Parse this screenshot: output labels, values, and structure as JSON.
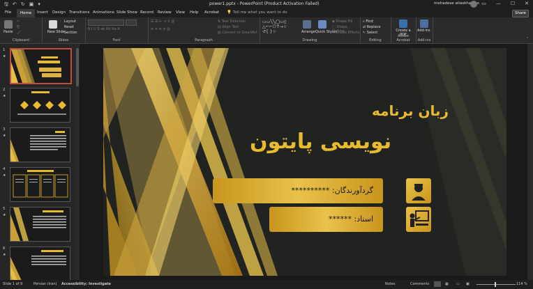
{
  "titlebar": {
    "autosave": "",
    "filename": "power1.pptx - PowerPoint (Product Activation Failed)",
    "user": "mohadese aliaskhanloo"
  },
  "tabs": [
    "File",
    "Home",
    "Insert",
    "Design",
    "Transitions",
    "Animations",
    "Slide Show",
    "Record",
    "Review",
    "View",
    "Help",
    "Acrobat"
  ],
  "tell_me": "Tell me what you want to do",
  "share_label": "Share",
  "ribbon": {
    "clipboard": {
      "label": "Clipboard",
      "paste": "Paste"
    },
    "slides": {
      "label": "Slides",
      "new_slide": "New Slide",
      "layout": "Layout",
      "reset": "Reset",
      "section": "Section"
    },
    "font": {
      "label": "Font"
    },
    "paragraph": {
      "label": "Paragraph"
    },
    "drawing": {
      "label": "Drawing",
      "arrange": "Arrange",
      "quick_styles": "Quick Styles"
    },
    "editing": {
      "label": "Editing",
      "find": "Find",
      "replace": "Replace",
      "select": "Select"
    },
    "adobe": {
      "label": "Adobe Acrobat",
      "create_pdf": "Create a PDF"
    },
    "addins": {
      "label": "Add-ins",
      "addins": "Add-ins"
    }
  },
  "thumbnails": [
    {
      "num": "1",
      "selected": true
    },
    {
      "num": "2",
      "selected": false
    },
    {
      "num": "3",
      "selected": false
    },
    {
      "num": "4",
      "selected": false
    },
    {
      "num": "5",
      "selected": false
    },
    {
      "num": "6",
      "selected": false
    }
  ],
  "slide": {
    "title_line1": "زبان برنامه",
    "title_line2": "نویسی پایتون",
    "collector_text": "گردآورندگان: **********",
    "professor_text": "استاد: ******"
  },
  "status": {
    "slide_info": "Slide 1 of 9",
    "language": "Persian (Iran)",
    "accessibility": "Accessibility: Investigate",
    "notes": "Notes",
    "comments": "Comments",
    "zoom": "114 %"
  },
  "colors": {
    "gold": "#e8bb2e",
    "dark_gold": "#c8951d",
    "slide_bg": "#212321",
    "accent_sel": "#c0503d"
  }
}
